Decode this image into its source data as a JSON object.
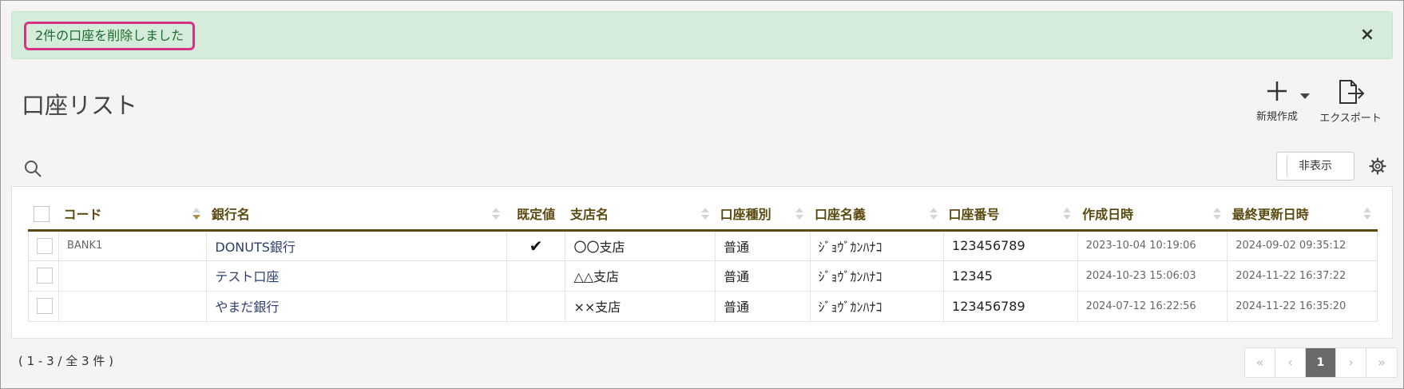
{
  "alert": {
    "message": "2件の口座を削除しました",
    "close": "×"
  },
  "page": {
    "title": "口座リスト"
  },
  "toolbar": {
    "new_label": "新規作成",
    "export_label": "エクスポート",
    "hide_label": "非表示"
  },
  "icons": {
    "search": "search-icon",
    "gear": "gear-icon",
    "plus": "plus-icon",
    "export": "export-icon",
    "close": "close-icon"
  },
  "table": {
    "headers": [
      "コード",
      "銀行名",
      "既定値",
      "支店名",
      "口座種別",
      "口座名義",
      "口座番号",
      "作成日時",
      "最終更新日時"
    ],
    "rows": [
      {
        "code": "BANK1",
        "bank": "DONUTS銀行",
        "default": "✔",
        "branch": "〇〇支店",
        "type": "普通",
        "holder": "ｼﾞｮｳﾞｶﾝﾊﾅｺ",
        "number": "123456789",
        "created": "2023-10-04 10:19:06",
        "updated": "2024-09-02 09:35:12"
      },
      {
        "code": "",
        "bank": "テスト口座",
        "default": "",
        "branch": "△△支店",
        "type": "普通",
        "holder": "ｼﾞｮｳﾞｶﾝﾊﾅｺ",
        "number": "12345",
        "created": "2024-10-23 15:06:03",
        "updated": "2024-11-22 16:37:22"
      },
      {
        "code": "",
        "bank": "やまだ銀行",
        "default": "",
        "branch": "××支店",
        "type": "普通",
        "holder": "ｼﾞｮｳﾞｶﾝﾊﾅｺ",
        "number": "123456789",
        "created": "2024-07-12 16:22:56",
        "updated": "2024-11-22 16:35:20"
      }
    ]
  },
  "footer": {
    "count_text": "( 1 - 3 / 全 3 件 )"
  },
  "pagination": {
    "first": "«",
    "prev": "‹",
    "current": "1",
    "next": "›",
    "last": "»"
  },
  "colors": {
    "alert_bg": "#d4ecd9",
    "alert_text": "#1d6b2f",
    "highlight": "#d63384",
    "header_text": "#5a4a10"
  }
}
